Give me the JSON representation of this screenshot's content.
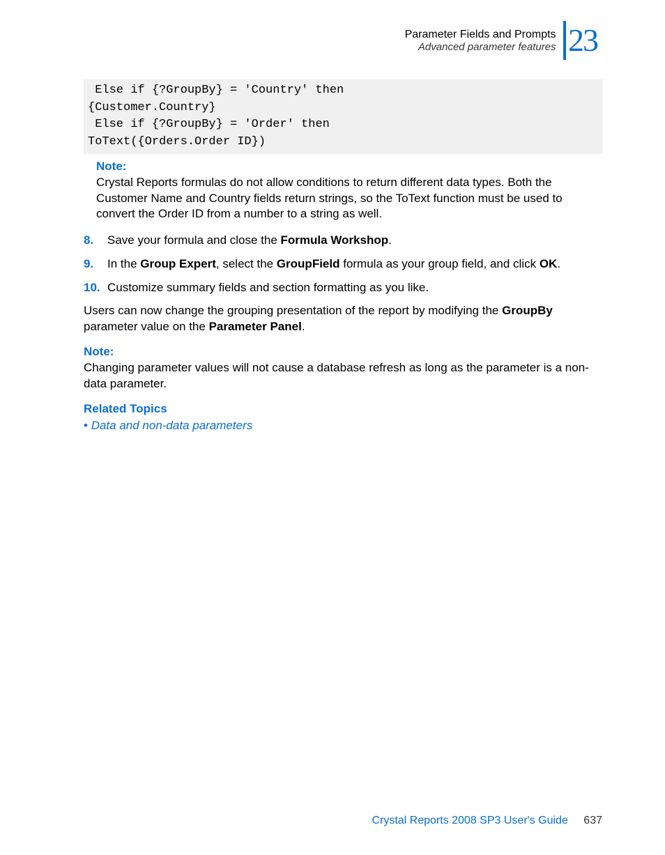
{
  "header": {
    "line1": "Parameter Fields and Prompts",
    "line2": "Advanced parameter features",
    "chapter_number": "23"
  },
  "code": " Else if {?GroupBy} = 'Country' then\n{Customer.Country}\n Else if {?GroupBy} = 'Order' then\nToText({Orders.Order ID})",
  "note1": {
    "label": "Note:",
    "body": "Crystal Reports formulas do not allow conditions to return different data types. Both the Customer Name and Country fields return strings, so the ToText function must be used to convert the Order ID from a number to a string as well."
  },
  "steps": [
    {
      "num": "8.",
      "parts": [
        {
          "t": "Save your formula and close the "
        },
        {
          "t": "Formula Workshop",
          "bold": true
        },
        {
          "t": "."
        }
      ]
    },
    {
      "num": "9.",
      "parts": [
        {
          "t": "In the "
        },
        {
          "t": "Group Expert",
          "bold": true
        },
        {
          "t": ", select the "
        },
        {
          "t": "GroupField",
          "bold": true
        },
        {
          "t": " formula as your group field, and click "
        },
        {
          "t": "OK",
          "bold": true
        },
        {
          "t": "."
        }
      ]
    },
    {
      "num": "10.",
      "parts": [
        {
          "t": "Customize summary fields and section formatting as you like."
        }
      ]
    }
  ],
  "body_after_steps": {
    "parts": [
      {
        "t": "Users can now change the grouping presentation of the report by modifying the "
      },
      {
        "t": "GroupBy",
        "bold": true
      },
      {
        "t": " parameter value on the "
      },
      {
        "t": "Parameter Panel",
        "bold": true
      },
      {
        "t": "."
      }
    ]
  },
  "note2": {
    "label": "Note:",
    "body": "Changing parameter values will not cause a database refresh as long as the parameter is a non-data parameter."
  },
  "related": {
    "heading": "Related Topics",
    "items": [
      "Data and non-data parameters"
    ]
  },
  "footer": {
    "text": "Crystal Reports 2008 SP3 User's Guide",
    "page": "637"
  }
}
